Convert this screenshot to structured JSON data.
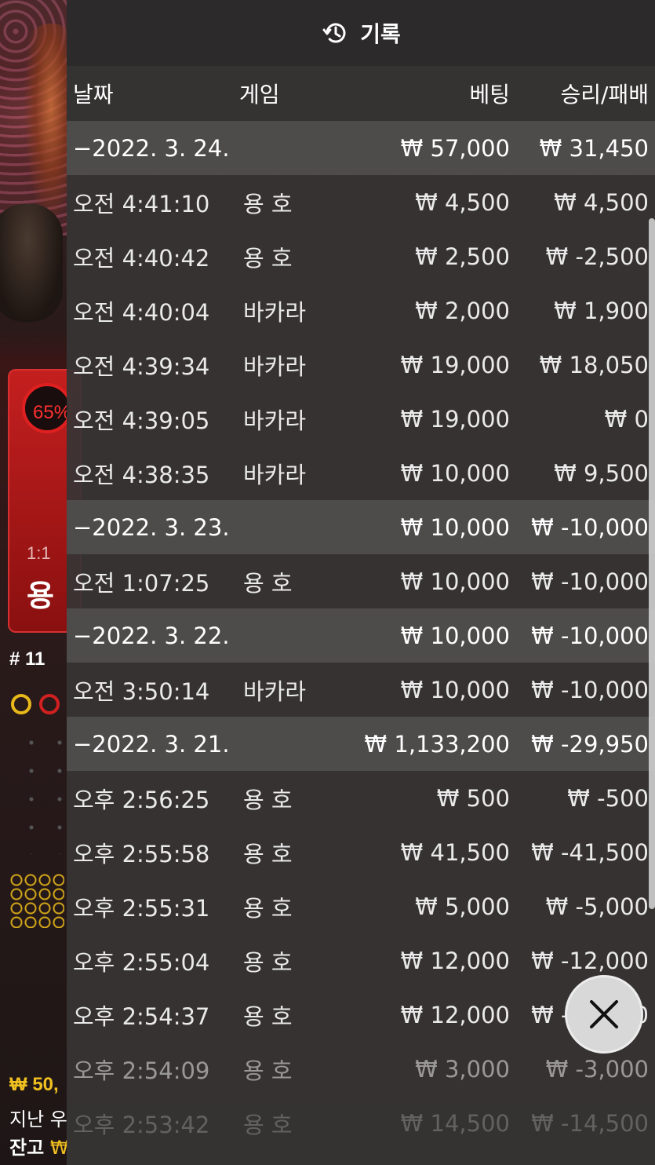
{
  "header": {
    "title": "기록",
    "icon": "history-icon"
  },
  "columns": {
    "date": "날짜",
    "game": "게임",
    "bet": "베팅",
    "winloss": "승리/패배"
  },
  "groups": [
    {
      "date": "−2022. 3. 24.",
      "bet": "₩ 57,000",
      "win": "₩ 31,450",
      "rows": [
        {
          "time": "오전 4:41:10",
          "game": "용 호",
          "bet": "₩ 4,500",
          "win": "₩ 4,500"
        },
        {
          "time": "오전 4:40:42",
          "game": "용 호",
          "bet": "₩ 2,500",
          "win": "₩ -2,500"
        },
        {
          "time": "오전 4:40:04",
          "game": "바카라",
          "bet": "₩ 2,000",
          "win": "₩ 1,900"
        },
        {
          "time": "오전 4:39:34",
          "game": "바카라",
          "bet": "₩ 19,000",
          "win": "₩ 18,050"
        },
        {
          "time": "오전 4:39:05",
          "game": "바카라",
          "bet": "₩ 19,000",
          "win": "₩ 0"
        },
        {
          "time": "오전 4:38:35",
          "game": "바카라",
          "bet": "₩ 10,000",
          "win": "₩ 9,500"
        }
      ]
    },
    {
      "date": "−2022. 3. 23.",
      "bet": "₩ 10,000",
      "win": "₩ -10,000",
      "rows": [
        {
          "time": "오전 1:07:25",
          "game": "용 호",
          "bet": "₩ 10,000",
          "win": "₩ -10,000"
        }
      ]
    },
    {
      "date": "−2022. 3. 22.",
      "bet": "₩ 10,000",
      "win": "₩ -10,000",
      "rows": [
        {
          "time": "오전 3:50:14",
          "game": "바카라",
          "bet": "₩ 10,000",
          "win": "₩ -10,000"
        }
      ]
    },
    {
      "date": "−2022. 3. 21.",
      "bet": "₩ 1,133,200",
      "win": "₩ -29,950",
      "rows": [
        {
          "time": "오후 2:56:25",
          "game": "용 호",
          "bet": "₩ 500",
          "win": "₩ -500"
        },
        {
          "time": "오후 2:55:58",
          "game": "용 호",
          "bet": "₩ 41,500",
          "win": "₩ -41,500"
        },
        {
          "time": "오후 2:55:31",
          "game": "용 호",
          "bet": "₩ 5,000",
          "win": "₩ -5,000"
        },
        {
          "time": "오후 2:55:04",
          "game": "용 호",
          "bet": "₩ 12,000",
          "win": "₩ -12,000"
        },
        {
          "time": "오후 2:54:37",
          "game": "용 호",
          "bet": "₩ 12,000",
          "win": "₩ -12,000"
        },
        {
          "time": "오후 2:54:09",
          "game": "용 호",
          "bet": "₩ 3,000",
          "win": "₩ -3,000"
        },
        {
          "time": "오후 2:53:42",
          "game": "용 호",
          "bet": "₩ 14,500",
          "win": "₩ -14,500"
        }
      ]
    }
  ],
  "background": {
    "percent": "65%",
    "odds": "1:1",
    "side_label": "용",
    "round": "# 11",
    "balance": "₩ 50,",
    "last_label": "지난 우",
    "remain_label": "잔고",
    "remain_value": "₩"
  },
  "close": {
    "icon": "close-icon"
  },
  "colors": {
    "panel": "#373434",
    "date_row": "#4e4b4b",
    "header": "#2c2a2a",
    "accent_red": "#c41f1f",
    "accent_gold": "#f0c020"
  }
}
